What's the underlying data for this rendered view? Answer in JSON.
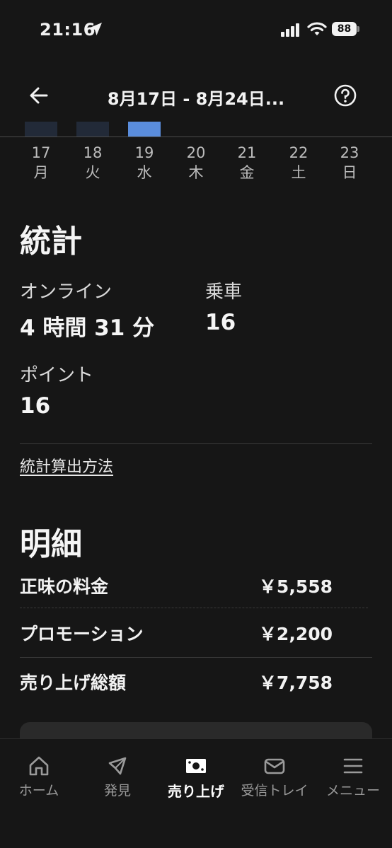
{
  "status_bar": {
    "time": "21:16",
    "battery": "88"
  },
  "header": {
    "title": "8月17日 - 8月24日..."
  },
  "chart_data": {
    "type": "bar",
    "categories": [
      "17",
      "18",
      "19"
    ],
    "selected": "19",
    "colors": {
      "inactive": "#222a38",
      "active": "#5a8ddc"
    }
  },
  "days": [
    {
      "num": "17",
      "weekday": "月"
    },
    {
      "num": "18",
      "weekday": "火"
    },
    {
      "num": "19",
      "weekday": "水"
    },
    {
      "num": "20",
      "weekday": "木"
    },
    {
      "num": "21",
      "weekday": "金"
    },
    {
      "num": "22",
      "weekday": "土"
    },
    {
      "num": "23",
      "weekday": "日"
    }
  ],
  "stats": {
    "title": "統計",
    "online_label": "オンライン",
    "online_value": "4 時間 31 分",
    "rides_label": "乗車",
    "rides_value": "16",
    "points_label": "ポイント",
    "points_value": "16",
    "method_link": "統計算出方法"
  },
  "breakdown": {
    "title": "明細",
    "rows": [
      {
        "label": "正味の料金",
        "value": "￥5,558"
      },
      {
        "label": "プロモーション",
        "value": "￥2,200"
      },
      {
        "label": "売り上げ総額",
        "value": "￥7,758"
      }
    ]
  },
  "nav": {
    "items": [
      {
        "label": "ホーム",
        "icon": "home-icon"
      },
      {
        "label": "発見",
        "icon": "compass-icon"
      },
      {
        "label": "売り上げ",
        "icon": "earnings-icon"
      },
      {
        "label": "受信トレイ",
        "icon": "inbox-icon"
      },
      {
        "label": "メニュー",
        "icon": "menu-icon"
      }
    ],
    "active": "売り上げ"
  },
  "colors": {
    "background": "#161616",
    "accent": "#5a8ddc"
  }
}
